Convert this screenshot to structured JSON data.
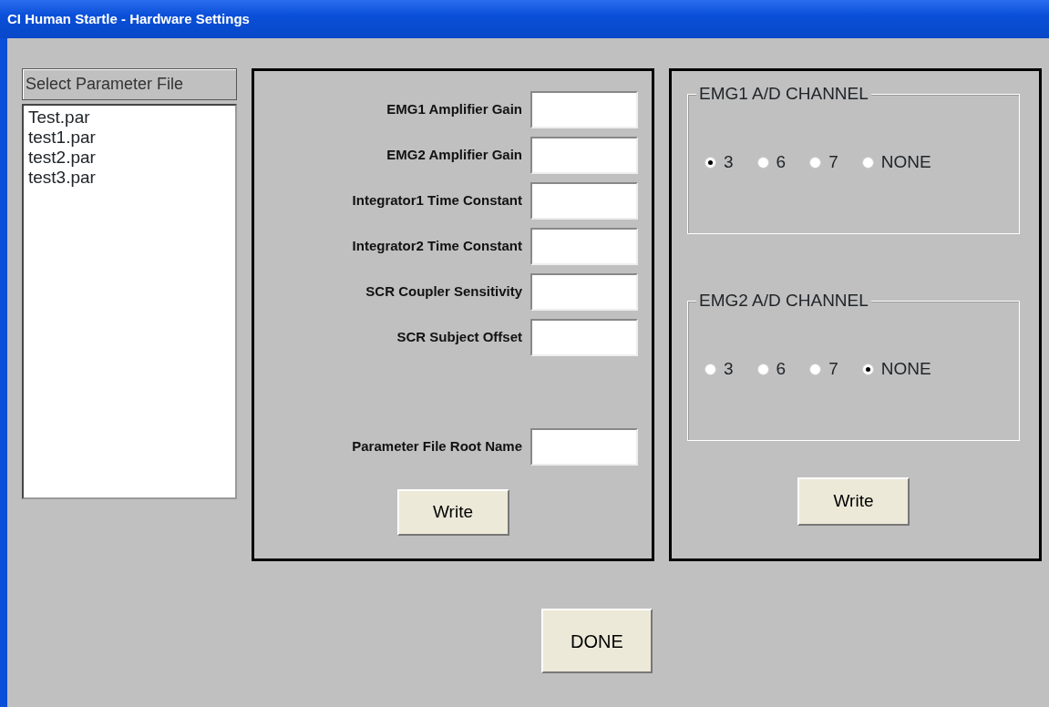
{
  "window": {
    "title": "CI Human Startle - Hardware Settings"
  },
  "file_list": {
    "label": "Select Parameter File",
    "items": [
      {
        "text": "Test.par",
        "selected": false
      },
      {
        "text": "test1.par",
        "selected": false
      },
      {
        "text": "test2.par",
        "selected": false
      },
      {
        "text": "test3.par",
        "selected": false
      }
    ]
  },
  "settings_panel": {
    "fields": [
      {
        "label": "EMG1 Amplifier Gain"
      },
      {
        "label": "EMG2 Amplifier Gain"
      },
      {
        "label": "Integrator1 Time Constant"
      },
      {
        "label": "Integrator2 Time Constant"
      },
      {
        "label": "SCR Coupler Sensitivity"
      },
      {
        "label": "SCR Subject Offset"
      }
    ],
    "root_name_field": {
      "label": "Parameter File Root Name"
    },
    "write_button": "Write"
  },
  "channel_panel": {
    "groups": [
      {
        "title": "EMG1 A/D CHANNEL",
        "options": [
          {
            "label": "3",
            "selected": true
          },
          {
            "label": "6",
            "selected": false
          },
          {
            "label": "7",
            "selected": false
          },
          {
            "label": "NONE",
            "selected": false
          }
        ]
      },
      {
        "title": "EMG2 A/D CHANNEL",
        "options": [
          {
            "label": "3",
            "selected": false
          },
          {
            "label": "6",
            "selected": false
          },
          {
            "label": "7",
            "selected": false
          },
          {
            "label": "NONE",
            "selected": true
          }
        ]
      }
    ],
    "write_button": "Write"
  },
  "done_button": "DONE"
}
